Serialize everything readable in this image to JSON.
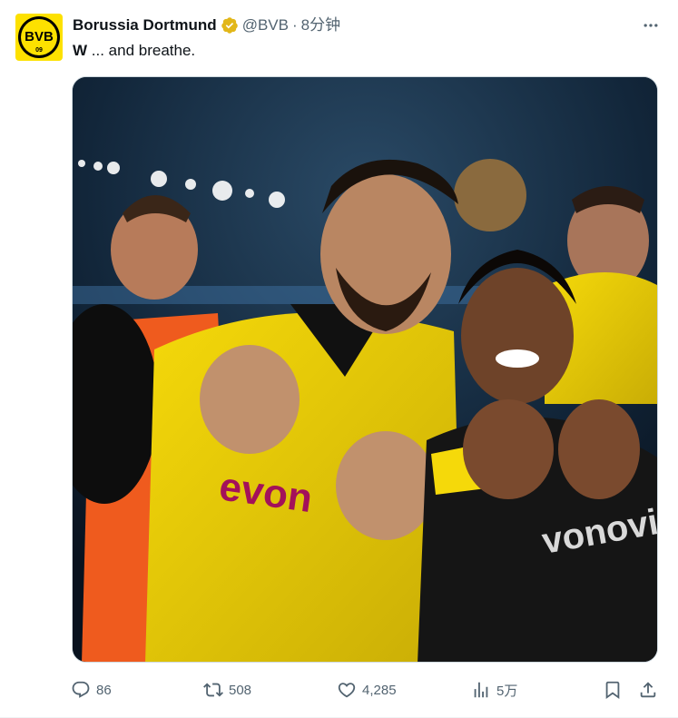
{
  "tweet": {
    "author_name": "Borussia Dortmund",
    "handle": "@BVB",
    "separator": "·",
    "time": "8分钟",
    "text_bold": "W",
    "text_rest": " ... and breathe.",
    "avatar_text": "BVB",
    "avatar_sub": "09",
    "image": {
      "description_icon": "photo",
      "sponsor_text": "evon",
      "jacket_text": "vonovia"
    }
  },
  "actions": {
    "reply_count": "86",
    "retweet_count": "508",
    "like_count": "4,285",
    "views_count": "5万"
  },
  "colors": {
    "bvb_yellow": "#fde100",
    "text_secondary": "#536471",
    "verified_gold": "#e2b719"
  }
}
